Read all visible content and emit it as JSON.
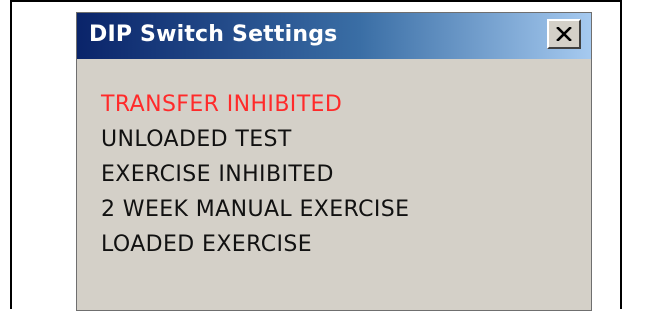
{
  "window": {
    "title": "DIP Switch Settings",
    "close_icon": "close-icon"
  },
  "settings": [
    {
      "label": "TRANSFER INHIBITED",
      "color": "#ff2a2a"
    },
    {
      "label": "UNLOADED TEST",
      "color": "#111111"
    },
    {
      "label": "EXERCISE INHIBITED",
      "color": "#111111"
    },
    {
      "label": "2 WEEK MANUAL EXERCISE",
      "color": "#111111"
    },
    {
      "label": "LOADED EXERCISE",
      "color": "#111111"
    }
  ],
  "colors": {
    "title_bar_start": "#0a246a",
    "title_bar_end": "#a6caf0",
    "window_bg": "#d4d0c8",
    "active_setting": "#ff2a2a"
  }
}
